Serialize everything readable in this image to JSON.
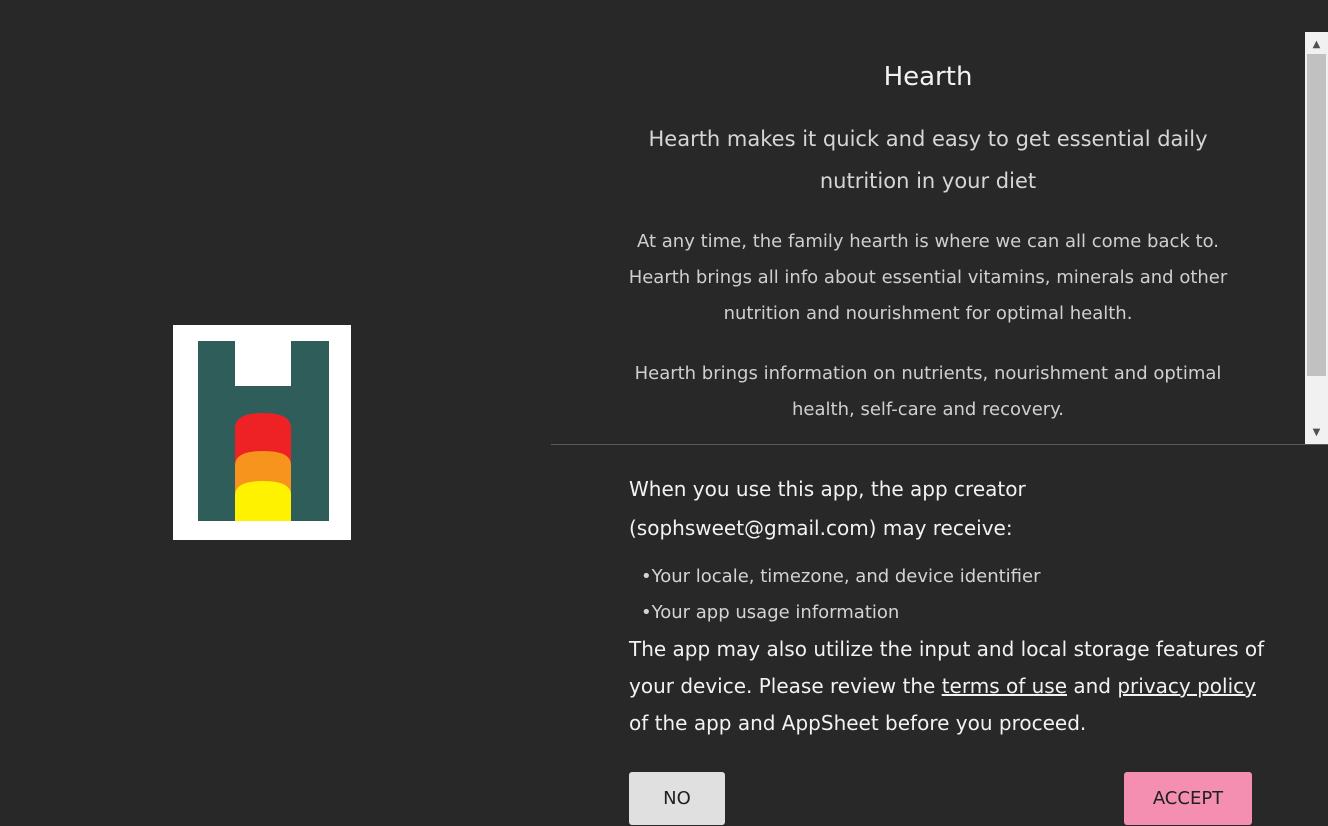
{
  "app": {
    "title": "Hearth",
    "tagline": "Hearth makes it quick and easy to get essential daily nutrition in your diet",
    "description": [
      "At any time, the family hearth is where we can all come back to. Hearth brings all info about essential vitamins, minerals and other nutrition and nourishment for optimal health.",
      "Hearth brings information on nutrients, nourishment and optimal health, self-care and recovery."
    ]
  },
  "logo": {
    "icon": "hearth-logo-icon",
    "colors": {
      "frame": "#2f5e5a",
      "top": "#ee2224",
      "middle": "#f7941d",
      "bottom": "#fff200"
    }
  },
  "consent": {
    "intro": "When you use this app, the app creator (sophsweet@gmail.com) may receive:",
    "items": [
      "Your locale, timezone, and device identifier",
      "Your app usage information"
    ],
    "footer_pre": "The app may also utilize the input and local storage features of your device. Please review the ",
    "terms_link": "terms of use",
    "footer_mid": " and ",
    "privacy_link": "privacy policy",
    "footer_post": " of the app and AppSheet before you proceed."
  },
  "buttons": {
    "no": "NO",
    "accept": "ACCEPT"
  },
  "colors": {
    "background": "#282828",
    "accept": "#f48fb1",
    "no": "#e0e0e0"
  }
}
